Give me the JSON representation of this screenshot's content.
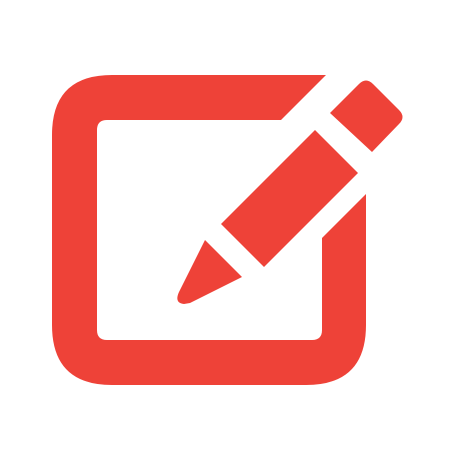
{
  "icon": {
    "name": "edit-icon",
    "parts": [
      "square-frame",
      "pencil"
    ],
    "color": "#EE4238",
    "background": "#FFFFFF"
  }
}
